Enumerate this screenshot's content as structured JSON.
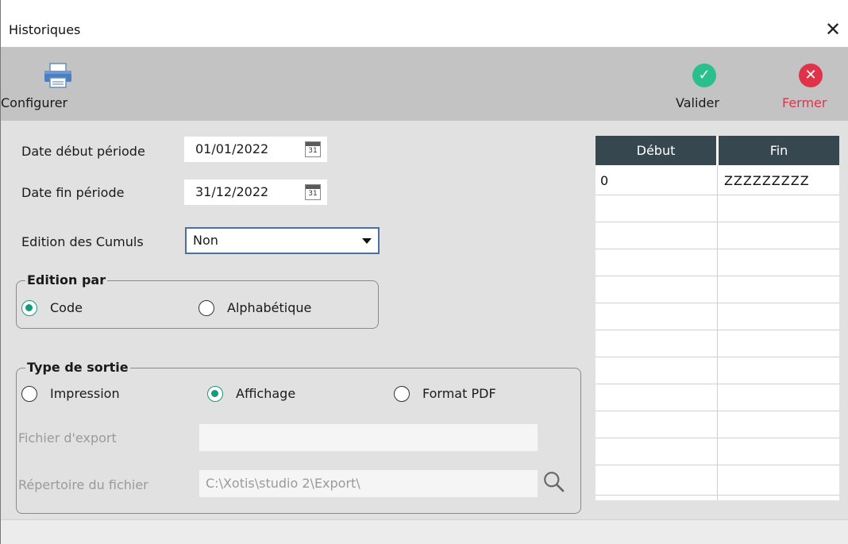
{
  "window": {
    "title": "Historiques",
    "close_symbol": "✕"
  },
  "toolbar": {
    "configurer_label": "Configurer",
    "valider_label": "Valider",
    "fermer_label": "Fermer",
    "colors": {
      "valider": "#2bbf8e",
      "fermer": "#e0334a",
      "fermer_text": "#e0334a",
      "toolbar_bg": "#c3c3c3"
    }
  },
  "form": {
    "date_debut": {
      "label": "Date début période",
      "value": "01/01/2022"
    },
    "date_fin": {
      "label": "Date fin période",
      "value": "31/12/2022"
    },
    "calendar_day": "31",
    "edition_cumuls": {
      "label": "Edition des Cumuls",
      "selected": "Non"
    },
    "edition_par": {
      "legend": "Edition par",
      "options": [
        {
          "label": "Code",
          "checked": true
        },
        {
          "label": "Alphabétique",
          "checked": false
        }
      ]
    },
    "type_sortie": {
      "legend": "Type de sortie",
      "options": [
        {
          "label": "Impression",
          "checked": false
        },
        {
          "label": "Affichage",
          "checked": true
        },
        {
          "label": "Format PDF",
          "checked": false
        }
      ],
      "fichier_export": {
        "label": "Fichier d'export",
        "value": ""
      },
      "repertoire": {
        "label": "Répertoire du fichier",
        "value": "C:\\Xotis\\studio 2\\Export\\"
      }
    }
  },
  "grid": {
    "headers": [
      "Début",
      "Fin"
    ],
    "rows": [
      [
        "0",
        "ZZZZZZZZZ"
      ]
    ],
    "header_color": "#37474f"
  },
  "accent": "#159a7c"
}
